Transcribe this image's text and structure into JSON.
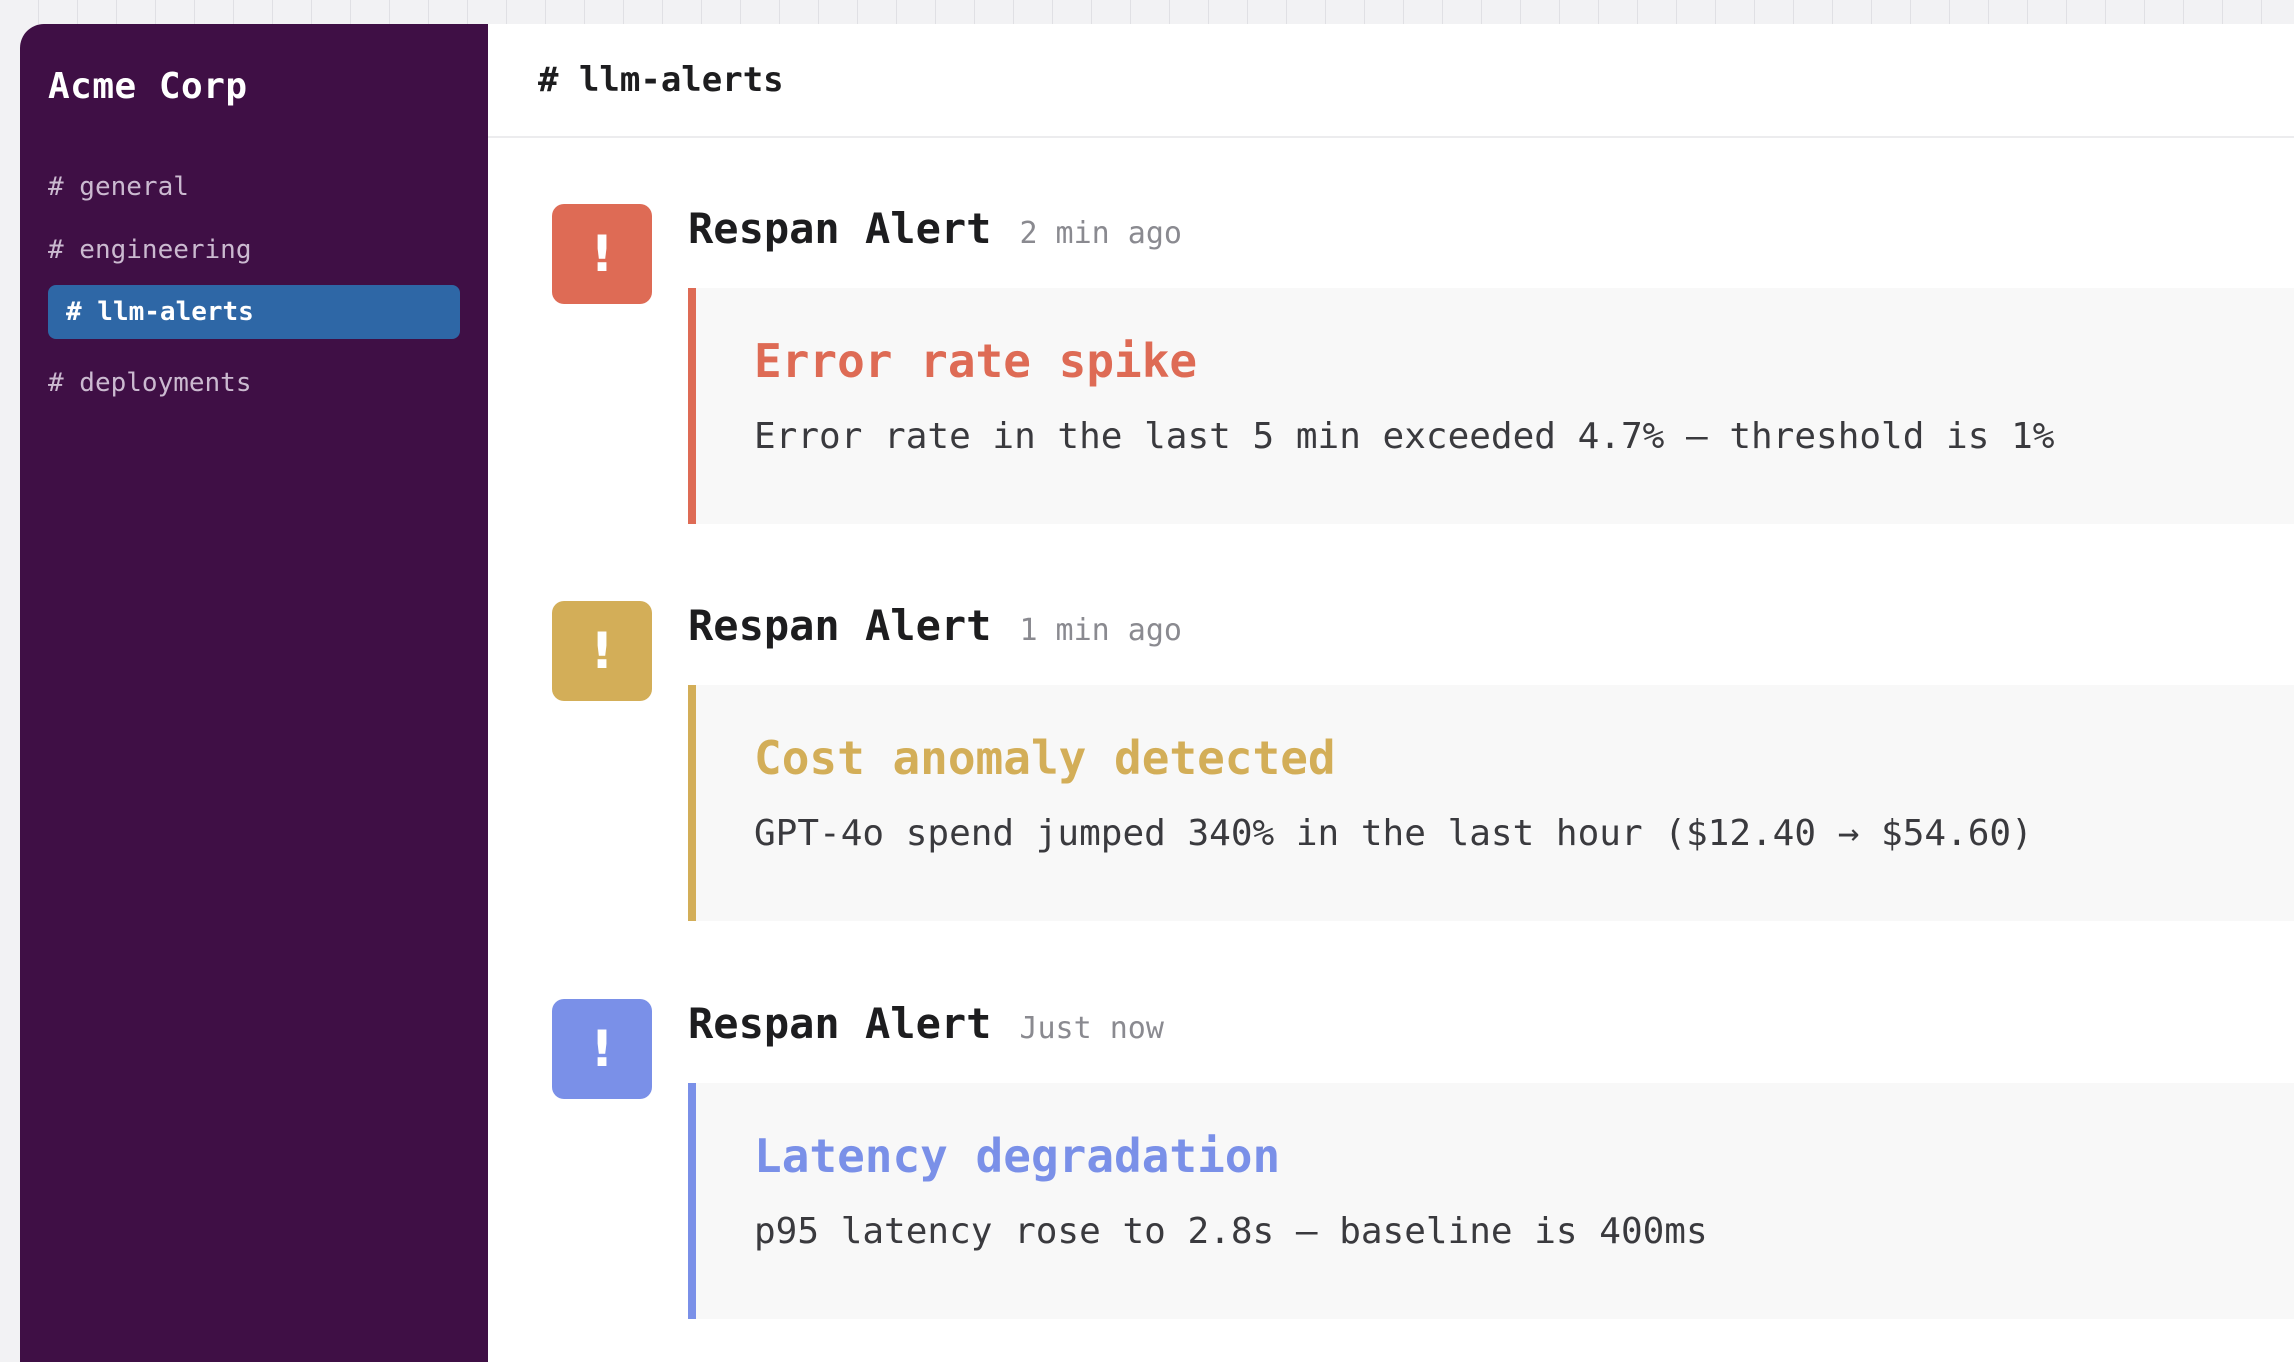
{
  "workspace": {
    "name": "Acme Corp"
  },
  "sidebar": {
    "channels": [
      {
        "label": "# general",
        "active": false
      },
      {
        "label": "# engineering",
        "active": false
      },
      {
        "label": "# llm-alerts",
        "active": true
      },
      {
        "label": "# deployments",
        "active": false
      }
    ]
  },
  "header": {
    "title": "# llm-alerts"
  },
  "messages": [
    {
      "author": "Respan Alert",
      "time": "2 min ago",
      "icon": "!",
      "icon_name": "alert-icon",
      "color": "#de6b55",
      "title": "Error rate spike",
      "body": "Error rate in the last 5 min exceeded 4.7% — threshold is 1%"
    },
    {
      "author": "Respan Alert",
      "time": "1 min ago",
      "icon": "!",
      "icon_name": "alert-icon",
      "color": "#d3ae58",
      "title": "Cost anomaly detected",
      "body": "GPT-4o spend jumped 340% in the last hour ($12.40 → $54.60)"
    },
    {
      "author": "Respan Alert",
      "time": "Just now",
      "icon": "!",
      "icon_name": "alert-icon",
      "color": "#7a90e8",
      "title": "Latency degradation",
      "body": "p95 latency rose to 2.8s — baseline is 400ms"
    }
  ],
  "colors": {
    "sidebar_bg": "#3f0f45",
    "active_channel_bg": "#2e67a6",
    "error": "#de6b55",
    "warning": "#d3ae58",
    "info": "#7a90e8"
  }
}
